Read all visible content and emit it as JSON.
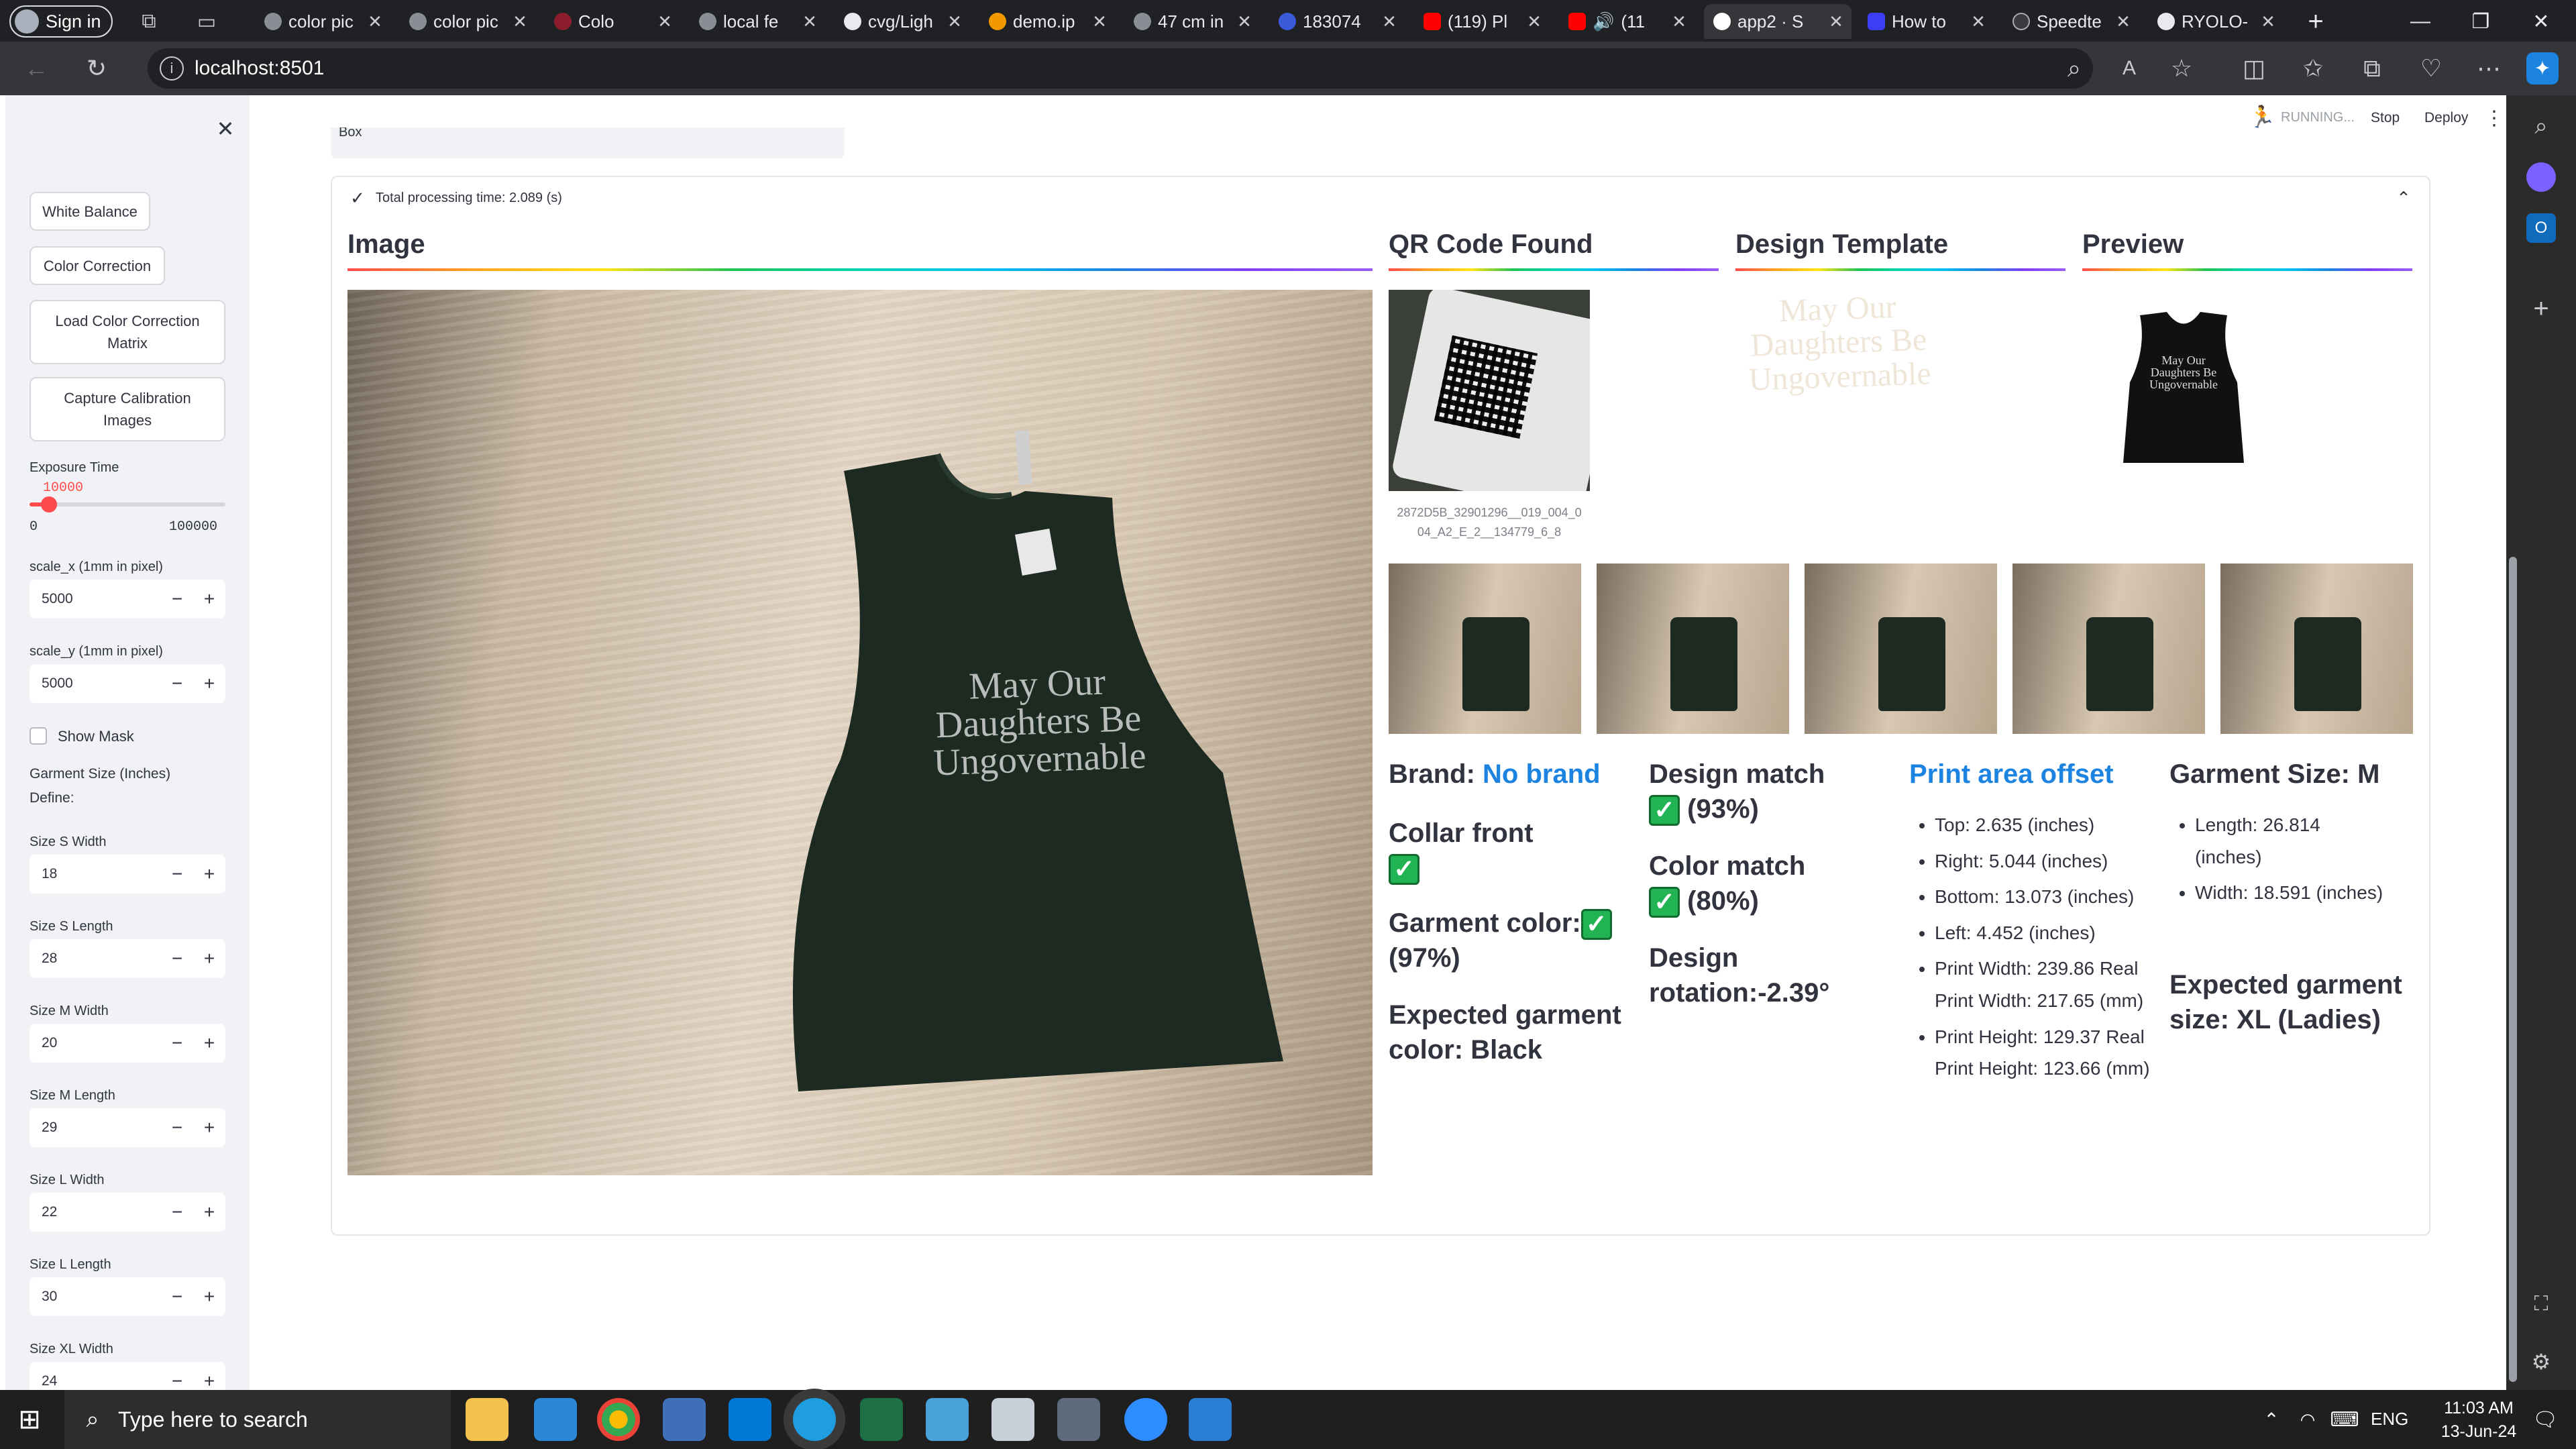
{
  "browser": {
    "signin_label": "Sign in",
    "tabs": [
      {
        "label": "color pic"
      },
      {
        "label": "color pic"
      },
      {
        "label": "Colo"
      },
      {
        "label": "local fe"
      },
      {
        "label": "cvg/Ligh"
      },
      {
        "label": "demo.ip"
      },
      {
        "label": "47 cm in"
      },
      {
        "label": "183074"
      },
      {
        "label": "(119) Pl"
      },
      {
        "label": "(11"
      },
      {
        "label": "app2 · S"
      },
      {
        "label": "How to"
      },
      {
        "label": "Speedte"
      },
      {
        "label": "RYOLO-"
      }
    ],
    "url": "localhost:8501"
  },
  "header": {
    "running": "RUNNING...",
    "stop": "Stop",
    "deploy": "Deploy"
  },
  "sidebar": {
    "white_balance": "White Balance",
    "color_correction": "Color Correction",
    "load_ccm_1": "Load Color Correction",
    "load_ccm_2": "Matrix",
    "capture_1": "Capture Calibration",
    "capture_2": "Images",
    "exposure_label": "Exposure Time",
    "exposure_value": "10000",
    "exposure_min": "0",
    "exposure_max": "100000",
    "exposure_level": 0.1,
    "scale_x_label": "scale_x (1mm in pixel)",
    "scale_x": "5000",
    "scale_y_label": "scale_y (1mm in pixel)",
    "scale_y": "5000",
    "show_mask": "Show Mask",
    "garment_size_1": "Garment Size (Inches)",
    "garment_size_2": "Define:",
    "size_s_width_label": "Size S Width",
    "size_s_width": "18",
    "size_s_length_label": "Size S Length",
    "size_s_length": "28",
    "size_m_width_label": "Size M Width",
    "size_m_width": "20",
    "size_m_length_label": "Size M Length",
    "size_m_length": "29",
    "size_l_width_label": "Size L Width",
    "size_l_width": "22",
    "size_l_length_label": "Size L Length",
    "size_l_length": "30",
    "size_xl_width_label": "Size XL Width",
    "size_xl_width": "24"
  },
  "main": {
    "top_input": "Box",
    "status": "Total processing time: 2.089 (s)",
    "col_image": "Image",
    "col_qr": "QR Code Found",
    "col_design": "Design Template",
    "col_preview": "Preview",
    "qr_caption_1": "2872D5B_32901296__019_004_0",
    "qr_caption_2": "04_A2_E_2__134779_6_8",
    "shirt_text_1": "May Our",
    "shirt_text_2": "Daughters Be",
    "shirt_text_3": "Ungovernable",
    "brand_label": "Brand:",
    "brand_value": "No brand",
    "collar": "Collar front",
    "garment_color": "Garment color:",
    "garment_color_pct": "(97%)",
    "expected_color": "Expected garment color: Black",
    "design_match": "Design match",
    "design_match_pct": "(93%)",
    "color_match": "Color match",
    "color_match_pct": "(80%)",
    "design_rotation": "Design rotation:-2.39°",
    "print_area_title": "Print area offset",
    "print_area": [
      "Top: 2.635 (inches)",
      "Right: 5.044 (inches)",
      "Bottom: 13.073 (inches)",
      "Left: 4.452 (inches)",
      "Print Width: 239.86 Real Print Width: 217.65 (mm)",
      "Print Height: 129.37 Real Print Height: 123.66 (mm)"
    ],
    "garment_size_title": "Garment Size: M",
    "garment_size": [
      "Length: 26.814 (inches)",
      "Width: 18.591 (inches)"
    ],
    "expected_size": "Expected garment size: XL (Ladies)"
  },
  "taskbar": {
    "search_placeholder": "Type here to search",
    "lang": "ENG",
    "time": "11:03 AM",
    "date": "13-Jun-24"
  },
  "colors": {
    "accent": "#ff4b4b",
    "link_blue": "#1c83e1",
    "check_green": "#21b354",
    "shirt": "#1c2a22",
    "table": "#c9b8a2"
  }
}
